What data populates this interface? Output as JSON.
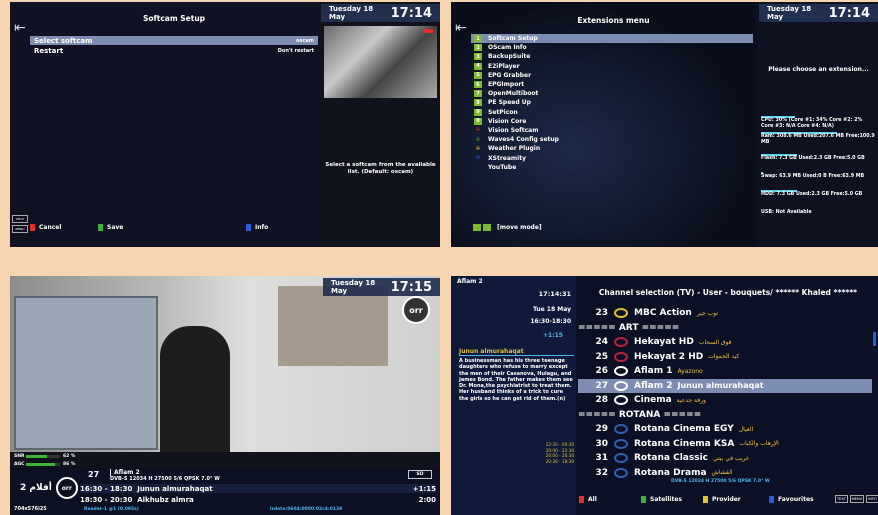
{
  "softcam": {
    "title": "Softcam Setup",
    "rows": [
      {
        "label": "Select softcam",
        "value": "oscam"
      },
      {
        "label": "Restart",
        "value": "Don't restart"
      }
    ],
    "info": "Select a softcam from the available list. (Default: oscam)",
    "date": "Tuesday 18 May",
    "time": "17:14",
    "footer": {
      "cancel": "Cancel",
      "save": "Save",
      "info": "Info"
    },
    "side_keys": [
      "HELP",
      "MENU"
    ]
  },
  "extensions": {
    "title": "Extensions menu",
    "date": "Tuesday 18 May",
    "time": "17:14",
    "prompt": "Please choose an extension...",
    "items": [
      {
        "key": "1",
        "label": "Softcam Setup"
      },
      {
        "key": "2",
        "label": "OScam Info"
      },
      {
        "key": "3",
        "label": "BackupSuite"
      },
      {
        "key": "4",
        "label": "E2iPlayer"
      },
      {
        "key": "5",
        "label": "EPG Grabber"
      },
      {
        "key": "6",
        "label": "EPGImport"
      },
      {
        "key": "7",
        "label": "OpenMultiboot"
      },
      {
        "key": "8",
        "label": "PE Speed Up"
      },
      {
        "key": "9",
        "label": "SetPicon"
      },
      {
        "key": "0",
        "label": "Vision Core"
      },
      {
        "key": "red",
        "label": "Vision Softcam"
      },
      {
        "key": "green",
        "label": "Waves4 Config setup"
      },
      {
        "key": "yellow",
        "label": "Weather Plugin"
      },
      {
        "key": "blue",
        "label": "XStreamity"
      },
      {
        "key": "",
        "label": "YouTube"
      }
    ],
    "stats": {
      "cpu": "CPU: 30% (Core #1: 34% Core #2: 2% Core #3: N/A Core #4: N/A)",
      "ram": "Ram: 308.6 MB Used:207.6 MB Free:100.9 MB",
      "flash": "Flash: 7.3 GB Used:2.3 GB Free:5.0 GB",
      "swap": "Swap: 63.9 MB Used:0 B Free:63.9 MB",
      "hdd": "HDD: 7.3 GB Used:2.3 GB Free:5.0 GB",
      "usb": "USB: Not Available"
    },
    "stat_fill": {
      "cpu": 0.3,
      "ram": 0.67,
      "flash": 0.32,
      "swap": 0.0,
      "hdd": 0.32
    },
    "footer": "[move mode]"
  },
  "infobar": {
    "date": "Tuesday 18 May",
    "time": "17:15",
    "channel_number": "27",
    "channel_name": "Aflam 2",
    "tp_info": "DVB-S 12034 H 27500 5/6 QPSK 7.0° W",
    "snr_label": "SNR",
    "snr": "62 %",
    "snr_fill": 0.62,
    "agc_label": "AGC",
    "agc": "86 %",
    "agc_fill": 0.86,
    "now": {
      "time": "16:30 - 18:30",
      "title": "Junun almurahaqat",
      "remaining": "+1:15"
    },
    "next": {
      "time": "18:30 - 20:30",
      "title": "Alkhubz almra",
      "duration": "2:00"
    },
    "resolution": "704x576i25",
    "reader": "Reader-1 @1 (0.095s)",
    "irdeto": "Irdeto:0604:0000:02c4:0138",
    "flags": [
      "SD"
    ],
    "logo_text": "أفلام 2",
    "logo_badge": "orr"
  },
  "channels": {
    "header_channel": "Aflam 2",
    "clock": "17:14:31",
    "date": "Tue 18 May",
    "slot": "16:30-18:30",
    "remaining": "+1:15",
    "title": "Channel selection (TV) - User - bouquets/ ****** Khaled ******",
    "event_title": "Junun almurahaqat",
    "event_desc": "A businessman has his three teenage daughters who refuse to marry except the men of their Casanova, Hulagu, and James Bond. The father makes them see Dr. Mona,the psychiatrist to treat them. Her husband thinks of a trick to cure the girls so he can get rid of them.(n)",
    "schedule": [
      "22:30 - 00:30",
      "20:00 - 22:30",
      "20:00 - 20:30",
      "20:30 - 18:30"
    ],
    "rows": [
      {
        "n": "23",
        "name": "MBC Action",
        "ar": "توب جير",
        "icon": "#e0c030",
        "type": "ch"
      },
      {
        "n": "",
        "name": "===== ART =====",
        "ar": "",
        "icon": "",
        "type": "sep"
      },
      {
        "n": "24",
        "name": "Hekayat HD",
        "ar": "فوق السحاب",
        "icon": "#c02040",
        "type": "ch"
      },
      {
        "n": "25",
        "name": "Hekayat 2 HD",
        "ar": "كيد الحموات",
        "icon": "#c02040",
        "type": "ch"
      },
      {
        "n": "26",
        "name": "Aflam 1",
        "ar": "Ayazono",
        "icon": "#ffffff",
        "type": "ch"
      },
      {
        "n": "27",
        "name": "Aflam 2",
        "ar": "Junun almurahaqat",
        "icon": "#ffffff",
        "type": "selected"
      },
      {
        "n": "28",
        "name": "Cinema",
        "ar": "ورقة جدعية",
        "icon": "#ffffff",
        "type": "ch"
      },
      {
        "n": "",
        "name": "===== ROTANA =====",
        "ar": "",
        "icon": "",
        "type": "sep"
      },
      {
        "n": "29",
        "name": "Rotana Cinema EGY",
        "ar": "الغيال",
        "icon": "#3060b0",
        "type": "ch"
      },
      {
        "n": "30",
        "name": "Rotana Cinema KSA",
        "ar": "الإرهاب والكباب",
        "icon": "#3060b0",
        "type": "ch"
      },
      {
        "n": "31",
        "name": "Rotana Classic",
        "ar": "غريب في بيتي",
        "icon": "#3060b0",
        "type": "ch"
      },
      {
        "n": "32",
        "name": "Rotana Drama",
        "ar": "القشاش",
        "icon": "#3060b0",
        "type": "ch"
      }
    ],
    "tp_info": "DVB-S 12034 H 27500 5/6 QPSK 7.0° W",
    "footer": {
      "all": "All",
      "satellites": "Satellites",
      "provider": "Provider",
      "favourites": "Favourites"
    },
    "keys": [
      "TEXT",
      "MENU",
      "INFO"
    ]
  },
  "colors": {
    "red": "#e0302a",
    "green": "#3fb23a",
    "yellow": "#e2c22a",
    "blue": "#2a5ce0",
    "select": "#7d8db2",
    "accent": "#5ad3f0"
  }
}
